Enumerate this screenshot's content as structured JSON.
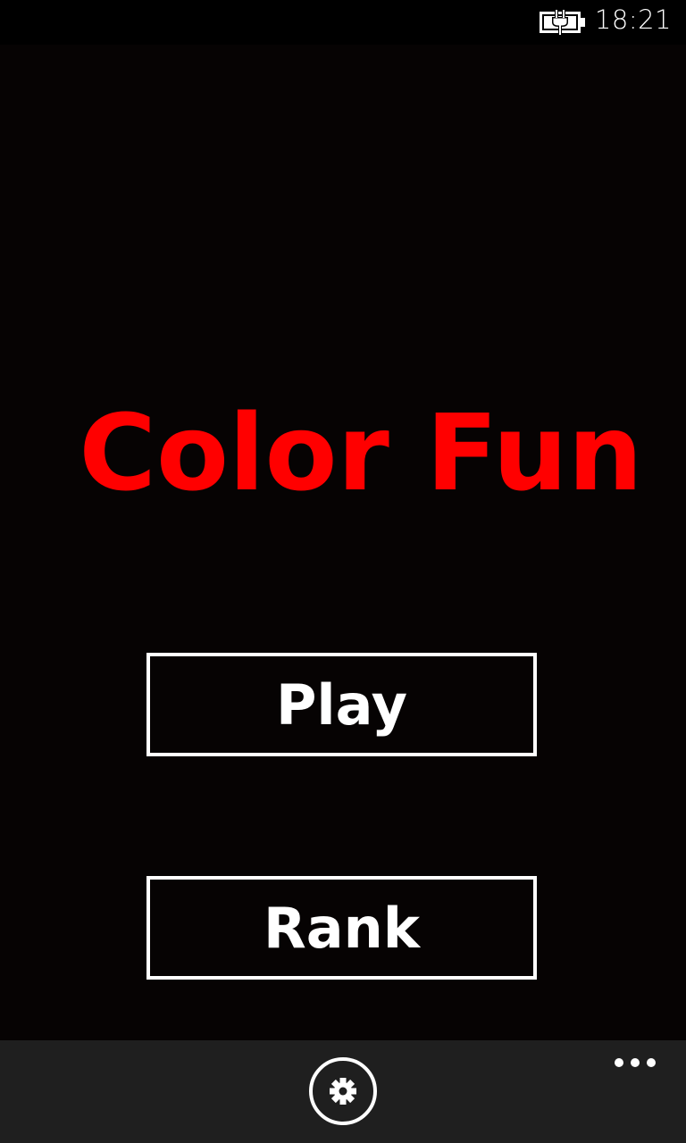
{
  "status_bar": {
    "time": "18:21",
    "battery_icon": "battery-charging-icon"
  },
  "main": {
    "title": "Color Fun",
    "title_color": "#ff0000",
    "buttons": {
      "play_label": "Play",
      "rank_label": "Rank"
    }
  },
  "app_bar": {
    "settings_icon": "gear-icon",
    "more_icon": "ellipsis-icon"
  },
  "colors": {
    "background": "#060303",
    "app_bar": "#1f1f1f",
    "foreground": "#ffffff"
  }
}
